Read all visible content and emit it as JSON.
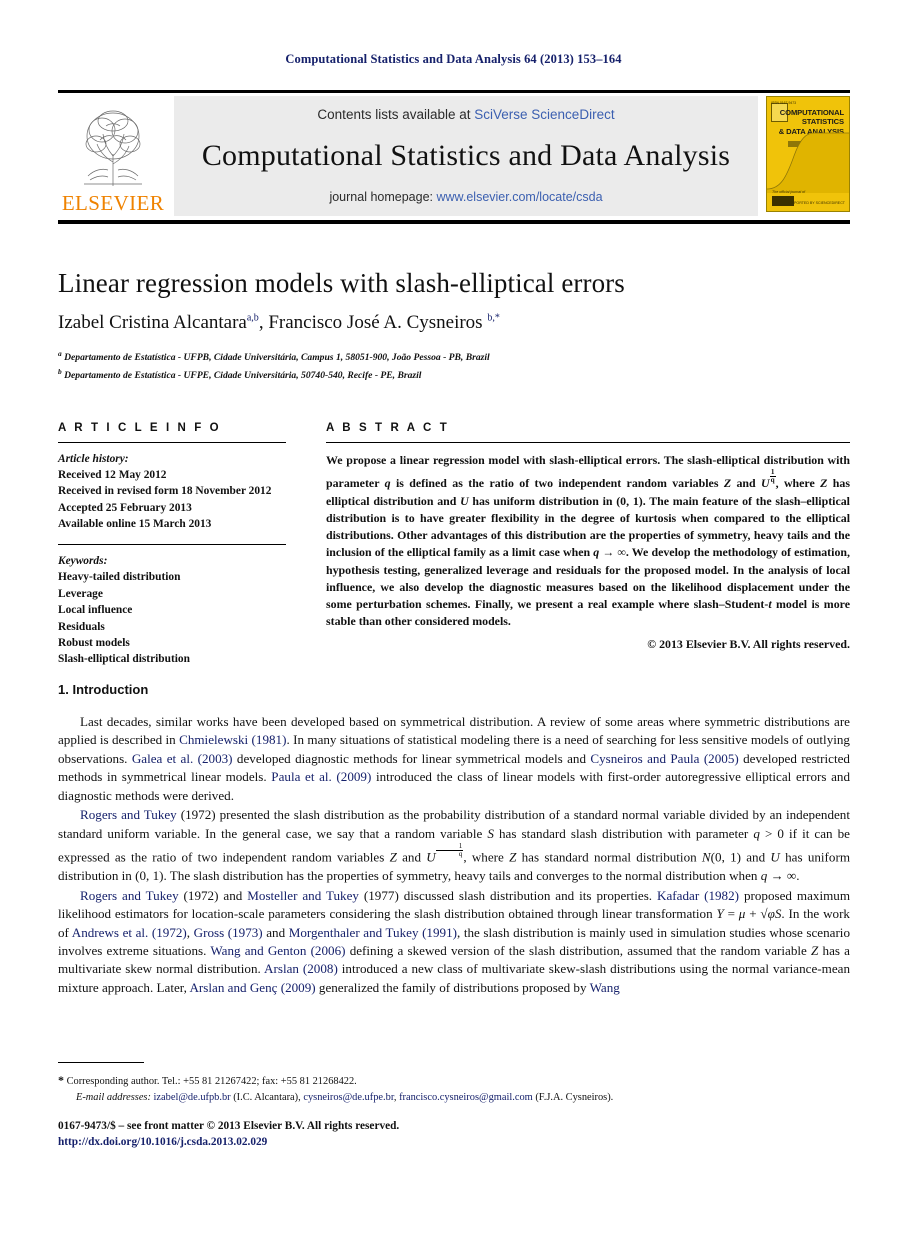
{
  "running_head": "Computational Statistics and Data Analysis 64 (2013) 153–164",
  "masthead": {
    "publisher_name": "ELSEVIER",
    "contents_prefix": "Contents lists available at ",
    "contents_link": "SciVerse ScienceDirect",
    "journal_name": "Computational Statistics and Data Analysis",
    "homepage_prefix": "journal homepage: ",
    "homepage_url": "www.elsevier.com/locate/csda",
    "cover": {
      "title_line1": "COMPUTATIONAL",
      "title_line2": "STATISTICS",
      "title_line3": "& DATA ANALYSIS",
      "official_text": "The official journal of",
      "issn_text": "ISSN 0167-9473",
      "footer_text": "SUPPORTED BY SCIENCEDIRECT"
    }
  },
  "article": {
    "title": "Linear regression models with slash-elliptical errors",
    "authors": "Izabel Cristina Alcantara",
    "author1_sup": "a,b",
    "author2": ", Francisco José A. Cysneiros",
    "author2_sup": "b,",
    "author2_star": "*",
    "affiliation_a_sup": "a",
    "affiliation_a": "Departamento de Estatística - UFPB, Cidade Universitária, Campus 1, 58051-900, João Pessoa - PB, Brazil",
    "affiliation_b_sup": "b",
    "affiliation_b": "Departamento de Estatística - UFPE, Cidade Universitária, 50740-540, Recife - PE, Brazil"
  },
  "article_info": {
    "heading": "A R T I C L E   I N F O",
    "history_label": "Article history:",
    "history": [
      "Received 12 May 2012",
      "Received in revised form 18 November 2012",
      "Accepted 25 February 2013",
      "Available online 15 March 2013"
    ],
    "keywords_label": "Keywords:",
    "keywords": [
      "Heavy-tailed distribution",
      "Leverage",
      "Local influence",
      "Residuals",
      "Robust models",
      "Slash-elliptical distribution"
    ]
  },
  "abstract": {
    "heading": "A B S T R A C T",
    "part1": "We propose a linear regression model with slash-elliptical errors. The slash-elliptical distribution with parameter ",
    "q1": "q",
    "part2": " is defined as the ratio of two independent random variables ",
    "z1": "Z",
    "part3": " and ",
    "u1": "U",
    "frac_num": "1",
    "frac_den": "q",
    "part4": ", where ",
    "z2": "Z",
    "part5": " has elliptical distribution and ",
    "u2": "U",
    "part6": " has uniform distribution in (0, 1). The main feature of the slash–elliptical distribution is to have greater flexibility in the degree of kurtosis when compared to the elliptical distributions. Other advantages of this distribution are the properties of symmetry, heavy tails and the inclusion of the elliptical family as a limit case when ",
    "q2": "q",
    "part7": " → ∞. We develop the methodology of estimation, hypothesis testing, generalized leverage and residuals for the proposed model. In the analysis of local influence, we also develop the diagnostic measures based on the likelihood displacement under the some perturbation schemes. Finally, we present a real example where slash–Student-",
    "t1": "t",
    "part8": " model is more stable than other considered models.",
    "copyright": "© 2013 Elsevier B.V. All rights reserved."
  },
  "introduction": {
    "heading": "1.  Introduction",
    "p1_a": "Last decades, similar works have been developed based on symmetrical distribution. A review of some areas where symmetric distributions are applied is described in ",
    "p1_cite1": "Chmielewski (1981)",
    "p1_b": ". In many situations of statistical modeling there is a need of searching for less sensitive models of outlying observations. ",
    "p1_cite2": "Galea et al. (2003)",
    "p1_c": " developed diagnostic methods for linear symmetrical models and ",
    "p1_cite3": "Cysneiros and Paula (2005)",
    "p1_d": " developed restricted methods in symmetrical linear models. ",
    "p1_cite4": "Paula et al. (2009)",
    "p1_e": " introduced the class of linear models with first-order autoregressive elliptical errors and diagnostic methods were derived.",
    "p2_cite1": "Rogers and Tukey",
    "p2_a": " (1972) presented the slash distribution as the probability distribution of a standard normal variable divided by an independent standard uniform variable. In the general case, we say that a random variable ",
    "p2_s": "S",
    "p2_b": " has standard slash distribution with parameter ",
    "p2_q": "q",
    "p2_c": " > 0 if it can be expressed as the ratio of two independent random variables ",
    "p2_z": "Z",
    "p2_d": " and ",
    "p2_u": "U",
    "p2_frac_num": "1",
    "p2_frac_den": "q",
    "p2_e": ", where ",
    "p2_z2": "Z",
    "p2_f": " has standard normal distribution ",
    "p2_n": "N",
    "p2_g": "(0, 1) and ",
    "p2_u2": "U",
    "p2_h": " has uniform distribution in (0, 1). The slash distribution has the properties of symmetry, heavy tails and converges to the normal distribution when ",
    "p2_q2": "q",
    "p2_i": " → ∞.",
    "p3_cite1": "Rogers and Tukey",
    "p3_a": " (1972) and ",
    "p3_cite2": "Mosteller and Tukey",
    "p3_b": " (1977) discussed slash distribution and its properties. ",
    "p3_cite3": "Kafadar (1982)",
    "p3_c": " proposed maximum likelihood estimators for location-scale parameters considering the slash distribution obtained through linear transformation ",
    "p3_formula_y": "Y",
    "p3_formula_eq": " = ",
    "p3_formula_mu": "μ",
    "p3_formula_plus": " + ",
    "p3_formula_sqrt": "√",
    "p3_formula_phi": "φ",
    "p3_formula_s": "S",
    "p3_d": ". In the work of ",
    "p3_cite4": "Andrews et al. (1972)",
    "p3_e": ", ",
    "p3_cite5": "Gross (1973)",
    "p3_f": " and ",
    "p3_cite6": "Morgenthaler and Tukey",
    "p3_g": " ",
    "p3_cite7": "(1991)",
    "p3_h": ", the slash distribution is mainly used in simulation studies whose scenario involves extreme situations. ",
    "p3_cite8": "Wang and Genton (2006)",
    "p3_i": " defining a skewed version of the slash distribution, assumed that the random variable ",
    "p3_z": "Z",
    "p3_j": " has a multivariate skew normal distribution. ",
    "p3_cite9": "Arslan (2008)",
    "p3_k": " introduced a new class of multivariate skew-slash distributions using the normal variance-mean mixture approach. Later, ",
    "p3_cite10": "Arslan and Genç (2009)",
    "p3_l": " generalized the family of distributions proposed by ",
    "p3_cite11": "Wang"
  },
  "footnotes": {
    "star": "*",
    "corresponding": " Corresponding author. Tel.: +55 81 21267422; fax: +55 81 21268422.",
    "email_label": "E-mail addresses:",
    "email1": "izabel@de.ufpb.br",
    "email1_owner": " (I.C. Alcantara), ",
    "email2": "cysneiros@de.ufpe.br",
    "email2_sep": ", ",
    "email3": "francisco.cysneiros@gmail.com",
    "email3_owner": " (F.J.A. Cysneiros)."
  },
  "imprint": {
    "line1": "0167-9473/$ – see front matter © 2013 Elsevier B.V. All rights reserved.",
    "doi": "http://dx.doi.org/10.1016/j.csda.2013.02.029"
  },
  "colors": {
    "link": "#16216b",
    "elsevier_orange": "#ef8200",
    "cover_yellow": "#f0c30a",
    "banner_gray": "#ebebeb",
    "sciencedirect_blue": "#3b5fb0"
  }
}
